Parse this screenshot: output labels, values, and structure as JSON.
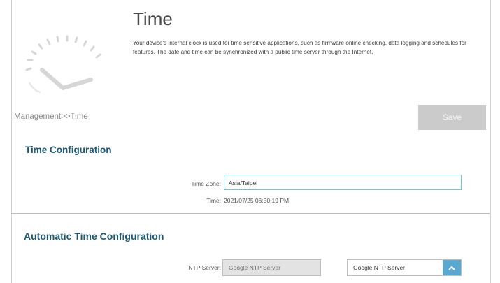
{
  "header": {
    "title": "Time",
    "description": "Your device's internal clock is used for time sensitive applications, such as firmware online checking, data logging and schedules for features. The date and time can be synchronized with a public time server through the Internet."
  },
  "breadcrumb": "Management>>Time",
  "toolbar": {
    "save_label": "Save"
  },
  "time_config": {
    "section_title": "Time Configuration",
    "timezone_label": "Time Zone:",
    "timezone_value": "Asia/Taipei",
    "time_label": "Time:",
    "time_value": "2021/07/25 06:50:19 PM"
  },
  "auto_time_config": {
    "section_title": "Automatic Time Configuration",
    "ntp_label": "NTP Server:",
    "ntp_input_value": "Google NTP Server",
    "ntp_select_value": "Google NTP Server"
  },
  "icons": {
    "clock": "clock-icon",
    "select_arrow": "chevron-up-icon"
  },
  "colors": {
    "section_title": "#1d5a73",
    "input_focus_border": "#6fc7dd",
    "select_arrow_bg": "#5aa7cf",
    "save_button_bg": "#cbcbcb"
  }
}
